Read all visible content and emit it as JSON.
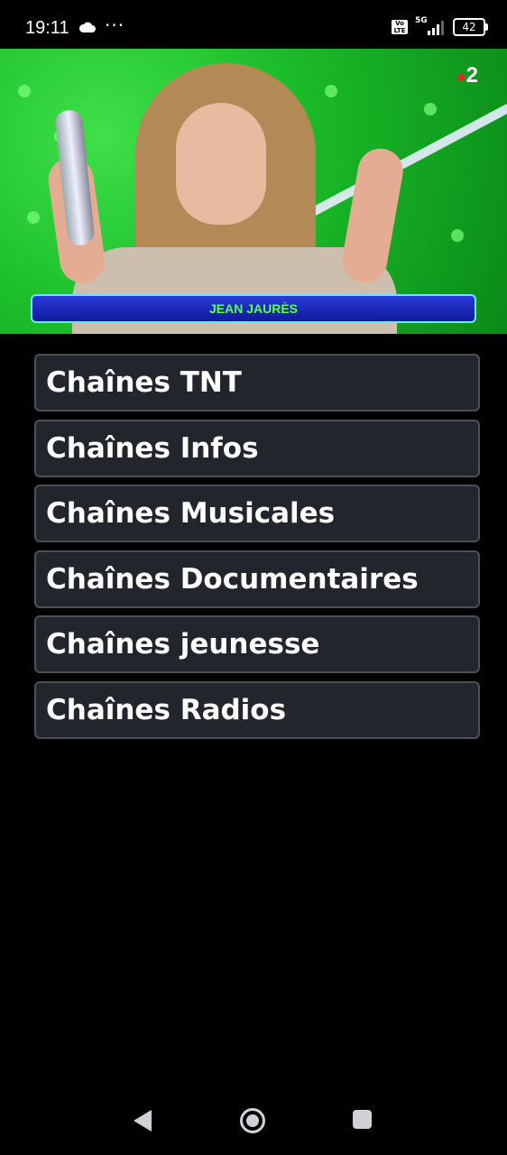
{
  "status_bar": {
    "time": "19:11",
    "dots": "···",
    "volte": "Vo LTE",
    "network": "5G",
    "battery": "42",
    "icons": [
      "cloud-icon",
      "volte-icon",
      "signal-icon",
      "battery-icon"
    ]
  },
  "video": {
    "channel_logo": "2",
    "lower_third": "JEAN JAURÈS"
  },
  "menu": {
    "items": [
      {
        "label": "Chaînes TNT"
      },
      {
        "label": "Chaînes Infos"
      },
      {
        "label": "Chaînes Musicales"
      },
      {
        "label": "Chaînes Documentaires"
      },
      {
        "label": "Chaînes jeunesse"
      },
      {
        "label": "Chaînes Radios"
      }
    ]
  },
  "nav_bar": {
    "icons": [
      "back-icon",
      "home-icon",
      "recents-icon"
    ]
  },
  "colors": {
    "background": "#000000",
    "menu_item_bg": "#22252b",
    "menu_item_border": "#4a5059",
    "video_green": "#1cbf2a",
    "lower_third_blue": "#1a2bc0",
    "lower_third_text": "#5cff4a"
  }
}
